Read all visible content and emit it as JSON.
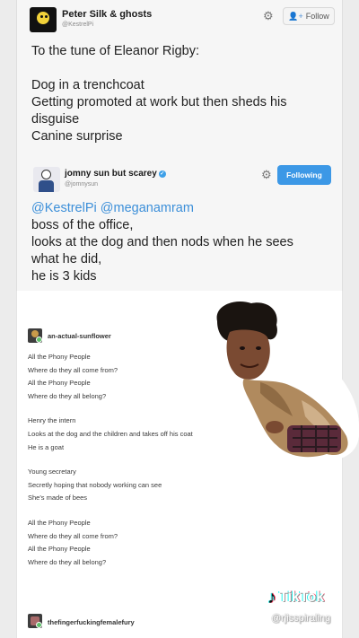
{
  "tweet1": {
    "name": "Peter Silk & ghosts",
    "handle": "@KestrelPi",
    "follow_label": "Follow",
    "lines": [
      "To the tune of Eleanor Rigby:",
      "Dog in a trenchcoat",
      "Getting promoted at work but then sheds his",
      "disguise",
      "Canine surprise"
    ]
  },
  "tweet2": {
    "name": "jomny sun but scarey",
    "handle": "@jomnysun",
    "following_label": "Following",
    "mentions": "@KestrelPi @meganamram",
    "lines": [
      "boss of the office,",
      "looks at the dog and then nods when he sees",
      "what he did,",
      "he is 3 kids"
    ]
  },
  "post": {
    "author": "an-actual-sunflower",
    "stanzas": [
      [
        "All the Phony People",
        "Where do they all come from?",
        "All the Phony People",
        "Where do they all belong?"
      ],
      [
        "Henry the intern",
        "Looks at the dog and the children and takes off his coat",
        "He is a goat"
      ],
      [
        "Young secretary",
        "Secretly hoping that nobody working can see",
        "She's made of bees"
      ],
      [
        "All the Phony People",
        "Where do they all come from?",
        "All the Phony People",
        "Where do they all belong?"
      ]
    ],
    "reblogger": "thefingerfuckingfemalefury"
  },
  "watermark": {
    "brand": "TikTok",
    "handle": "@rjisspiraling"
  },
  "icons": {
    "tweet_settings": "gear-icon",
    "follow": "add-person-icon",
    "verified": "verified-badge-icon",
    "tiktok_logo": "tiktok-note-icon"
  },
  "colors": {
    "link": "#3c8fd9",
    "following_button": "#3c98e6",
    "verified": "#3ea0e8"
  }
}
